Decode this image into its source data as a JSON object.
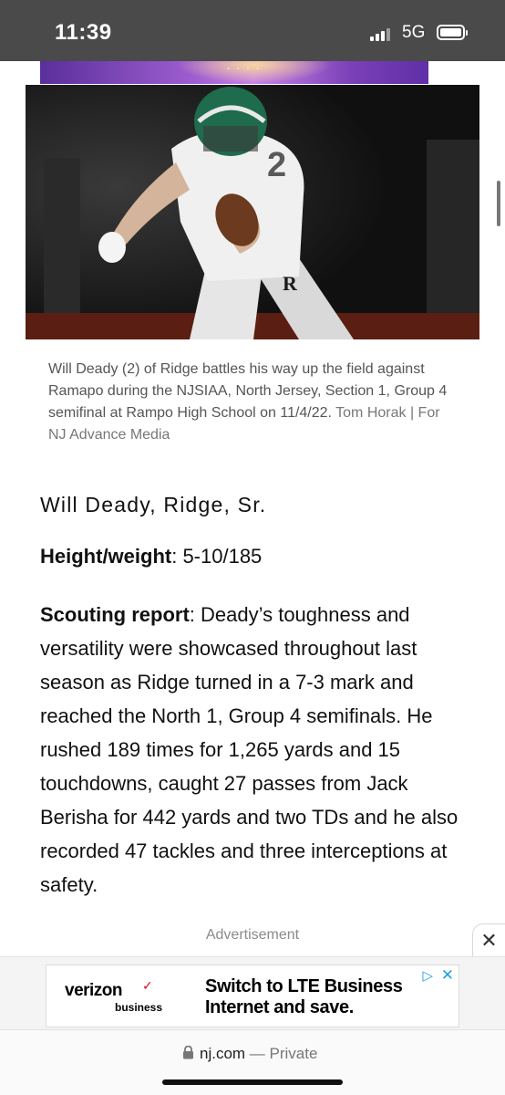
{
  "status_bar": {
    "time": "11:39",
    "network": "5G"
  },
  "photo": {
    "icon": "football-player-photo"
  },
  "caption": {
    "text": "Will Deady (2) of Ridge battles his way up the field against Ramapo during the NJSIAA, North Jersey, Section 1, Group 4 semifinal at Rampo High School on 11/4/22.",
    "credit": "Tom Horak | For NJ Advance Media"
  },
  "article": {
    "player_heading": "Will Deady, Ridge, Sr.",
    "height_weight_label": "Height/weight",
    "height_weight_value": ": 5-10/185",
    "scouting_label": "Scouting report",
    "scouting_text": ": Deady’s toughness and versatility were showcased throughout last season as Ridge turned in a 7-3 mark and reached the North 1, Group 4 semifinals. He rushed 189 times for 1,265 yards and 15 touchdowns, caught 27 passes from Jack Berisha for 442 yards and two TDs and he also recorded 47 tackles and three interceptions at safety."
  },
  "ad": {
    "label": "Advertisement",
    "close_symbol": "✕",
    "brand": "verizon",
    "brand_mark": "✓",
    "brand_sub": "business",
    "headline": "Switch to LTE Business Internet and save.",
    "adchoices_symbol": "▷",
    "dismiss_symbol": "✕"
  },
  "browser": {
    "domain": "nj.com",
    "separator": " — ",
    "mode": "Private"
  },
  "colors": {
    "status_bar_bg": "#4a4a4a",
    "caption_text": "#555555",
    "adchoices_blue": "#1ea1e5",
    "verizon_red": "#e2001a"
  }
}
